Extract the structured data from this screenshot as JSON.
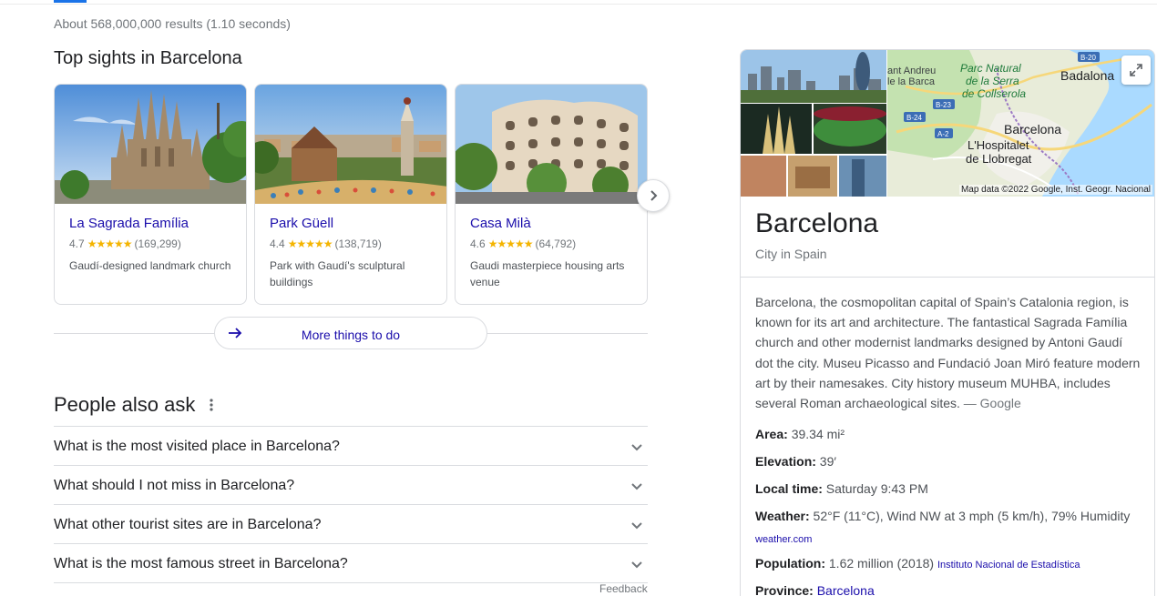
{
  "results_stats": "About 568,000,000 results (1.10 seconds)",
  "top_sights": {
    "title": "Top sights in Barcelona",
    "cards": [
      {
        "name": "La Sagrada Família",
        "rating": "4.7",
        "stars": "★★★★★",
        "reviews": "(169,299)",
        "description": "Gaudí-designed landmark church"
      },
      {
        "name": "Park Güell",
        "rating": "4.4",
        "stars": "★★★★★",
        "reviews": "(138,719)",
        "description": "Park with Gaudí's sculptural buildings"
      },
      {
        "name": "Casa Milà",
        "rating": "4.6",
        "stars": "★★★★★",
        "reviews": "(64,792)",
        "description": "Gaudi masterpiece housing arts venue"
      }
    ],
    "more_button": "More things to do"
  },
  "people_also_ask": {
    "title": "People also ask",
    "questions": [
      "What is the most visited place in Barcelona?",
      "What should I not miss in Barcelona?",
      "What other tourist sites are in Barcelona?",
      "What is the most famous street in Barcelona?"
    ],
    "feedback": "Feedback"
  },
  "knowledge_panel": {
    "title": "Barcelona",
    "subtitle": "City in Spain",
    "map_credit": "Map data ©2022 Google, Inst. Geogr. Nacional",
    "map_labels": {
      "badalona": "Badalona",
      "barcelona": "Barcelona",
      "hospitalet_1": "L'Hospitalet",
      "hospitalet_2": "de Llobregat",
      "park_1": "Parc Natural",
      "park_2": "de la Serra",
      "park_3": "de Collserola",
      "sant_andreu_1": "ant Andreu",
      "sant_andreu_2": "le la Barca",
      "road_b20": "B-20",
      "road_b23": "B-23",
      "road_b24": "B-24",
      "road_a2": "A-2"
    },
    "description": "Barcelona, the cosmopolitan capital of Spain’s Catalonia region, is known for its art and architecture. The fantastical Sagrada Família church and other modernist landmarks designed by Antoni Gaudí dot the city. Museu Picasso and Fundació Joan Miró feature modern art by their namesakes. City history museum MUHBA, includes several Roman archaeological sites.",
    "description_source": "— Google",
    "facts": {
      "area_label": "Area:",
      "area_value": "39.34 mi²",
      "elevation_label": "Elevation:",
      "elevation_value": "39′",
      "time_label": "Local time:",
      "time_value": "Saturday 9:43 PM",
      "weather_label": "Weather:",
      "weather_value": "52°F (11°C), Wind NW at 3 mph (5 km/h), 79% Humidity",
      "weather_source": "weather.com",
      "population_label": "Population:",
      "population_value": "1.62 million (2018)",
      "population_source": "Instituto Nacional de Estadística",
      "province_label": "Province:",
      "province_value": "Barcelona"
    }
  },
  "colors": {
    "link": "#1a0dab",
    "star": "#f4b400",
    "accent": "#1a73e8",
    "border": "#dadce0"
  }
}
